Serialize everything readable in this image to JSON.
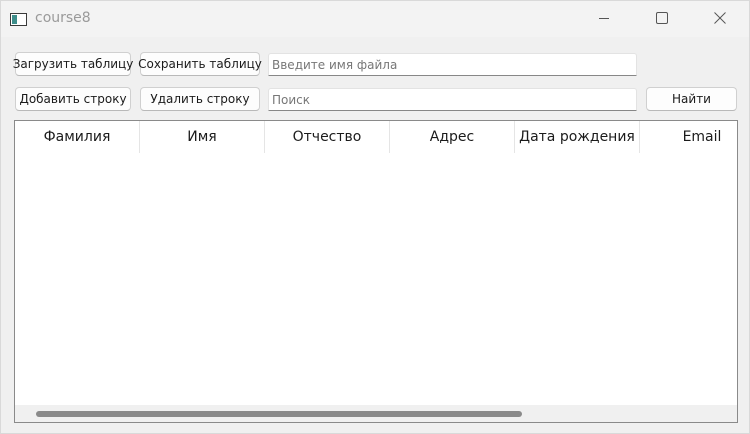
{
  "window": {
    "title": "course8"
  },
  "toolbar": {
    "load_label": "Загрузить таблицу",
    "save_label": "Сохранить таблицу",
    "add_label": "Добавить строку",
    "delete_label": "Удалить строку",
    "find_label": "Найти"
  },
  "inputs": {
    "filename_value": "",
    "filename_placeholder": "Введите имя файла",
    "search_value": "",
    "search_placeholder": "Поиск"
  },
  "table": {
    "columns": [
      "Фамилия",
      "Имя",
      "Отчество",
      "Адрес",
      "Дата рождения",
      "Email"
    ],
    "rows": []
  },
  "icons": {
    "app": "app-window-icon",
    "minimize": "minimize-icon",
    "maximize": "maximize-icon",
    "close": "close-icon"
  },
  "colors": {
    "window_background": "#f0f0f0",
    "title_text": "#9a9a9a",
    "scrollbar_thumb": "#8a8a8a"
  }
}
